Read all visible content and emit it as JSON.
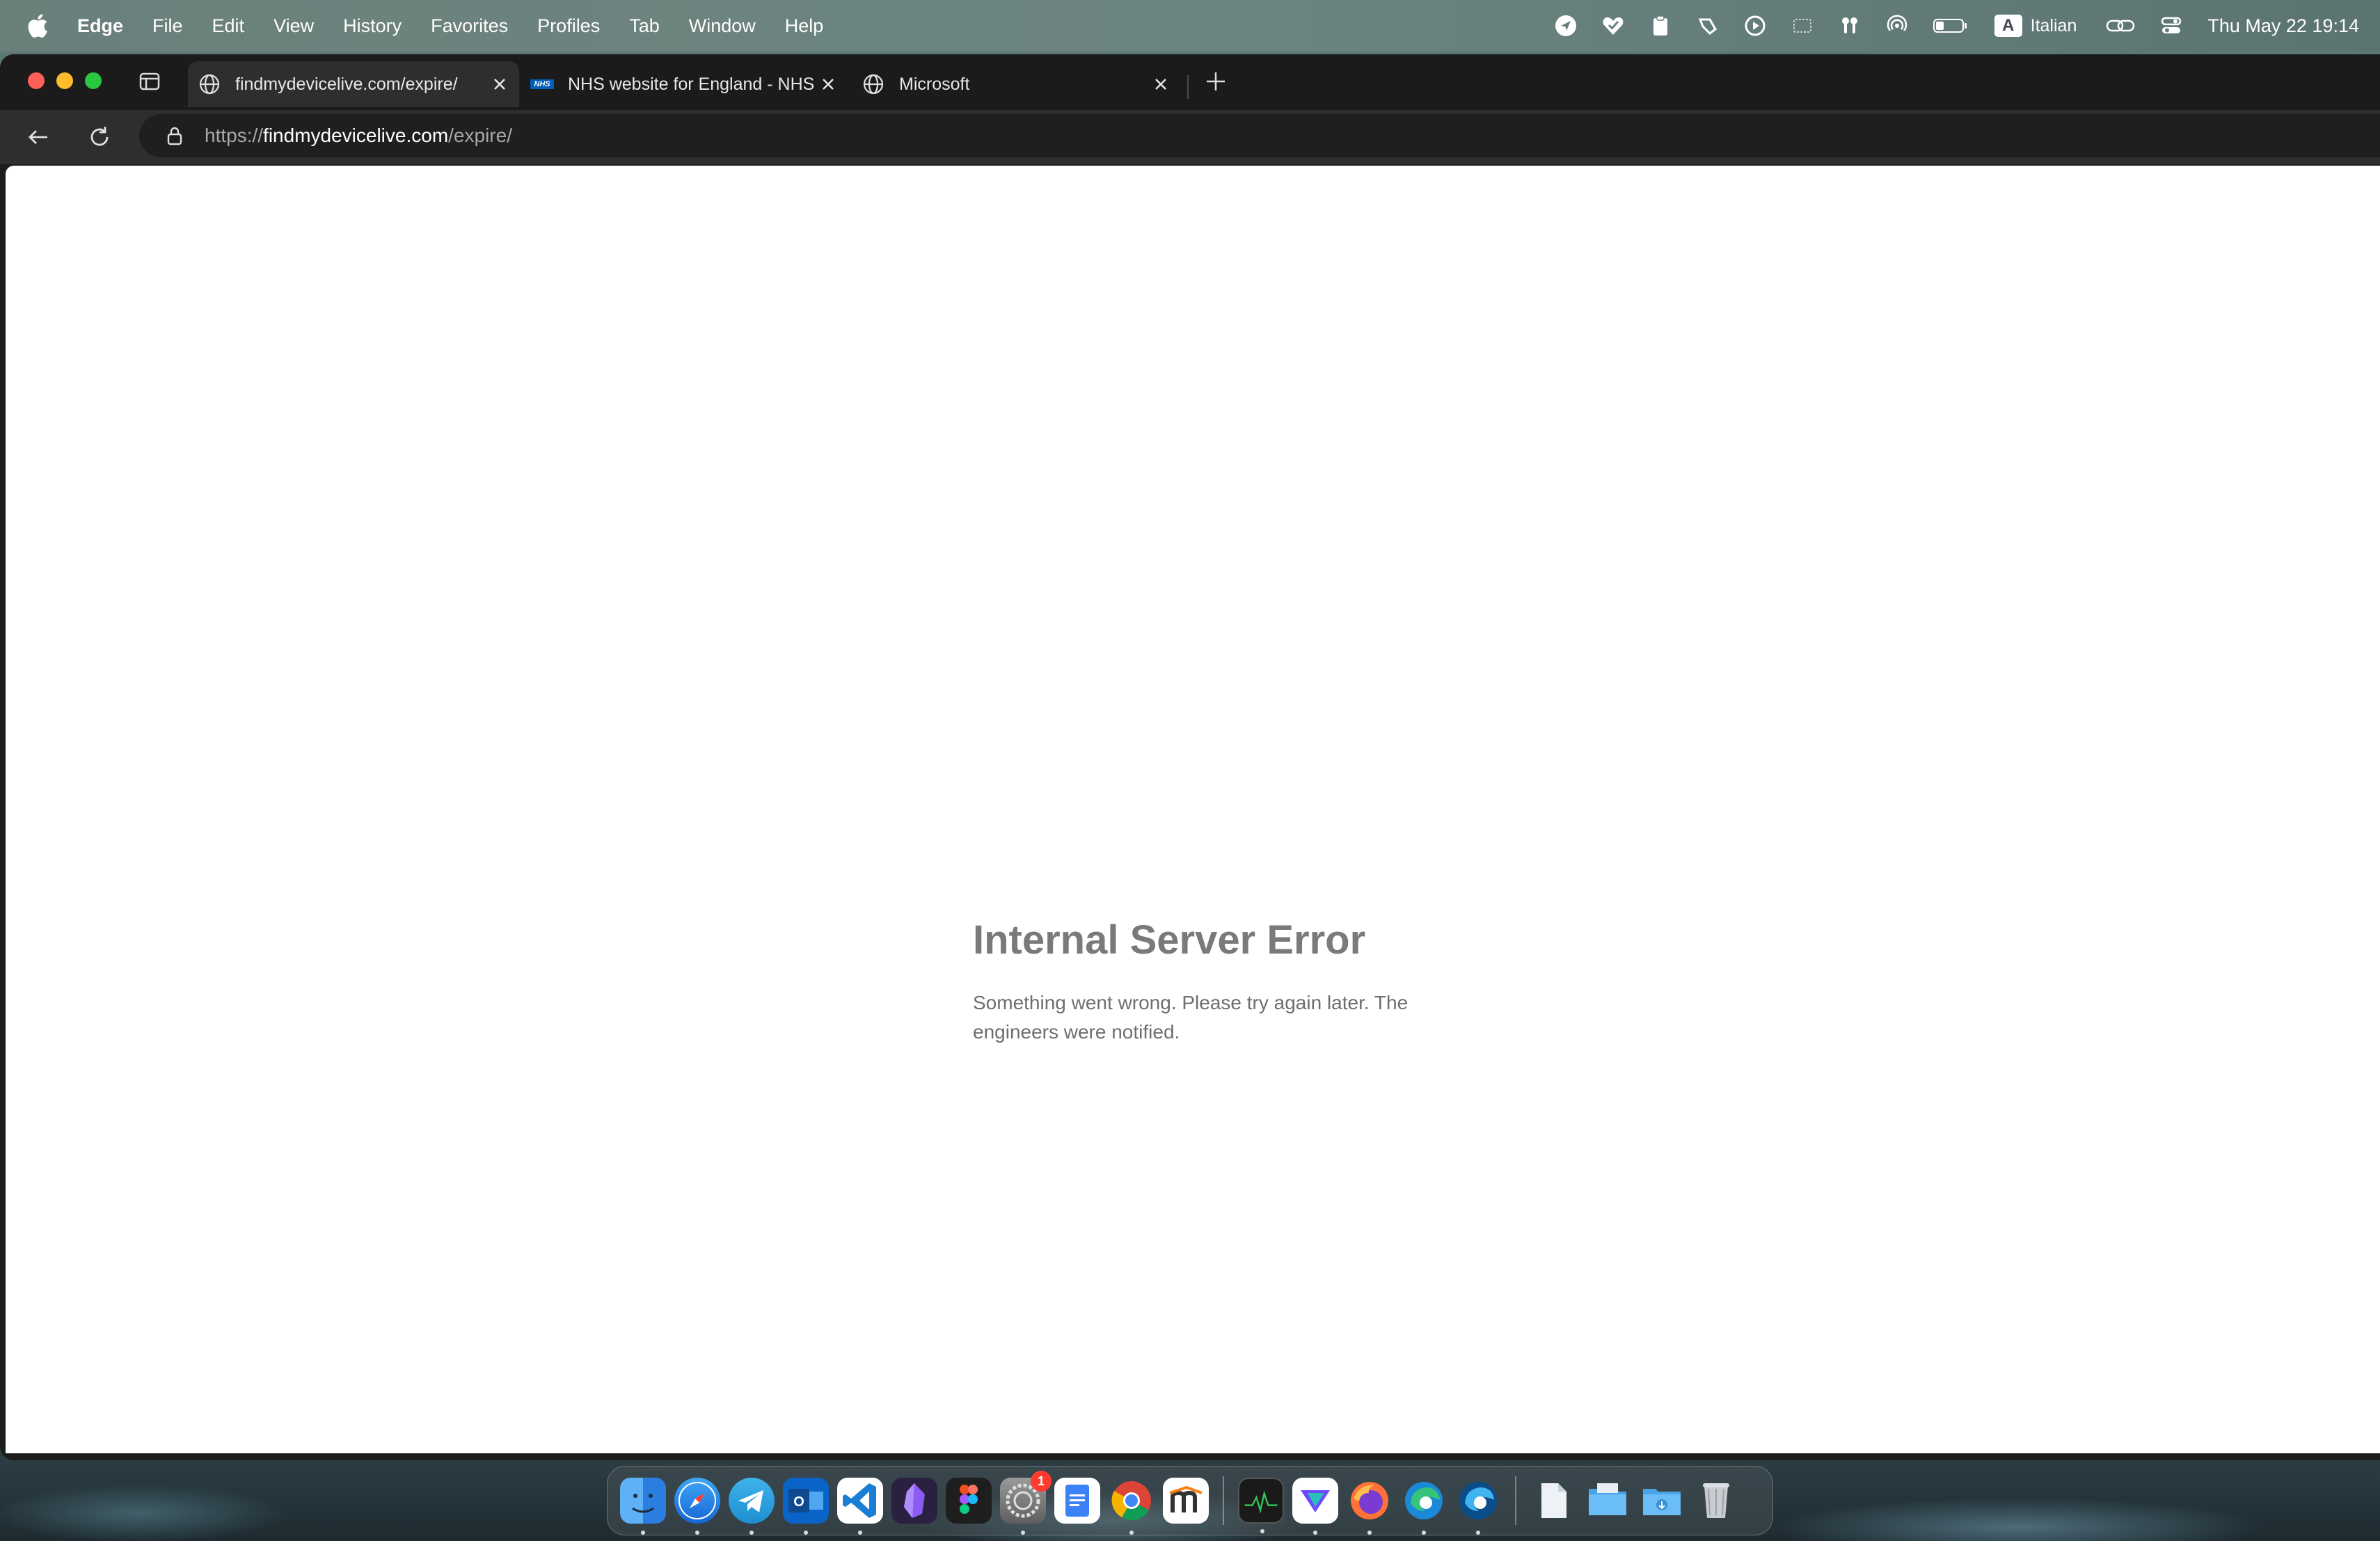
{
  "menubar": {
    "app_name": "Edge",
    "items": [
      "File",
      "Edit",
      "View",
      "History",
      "Favorites",
      "Profiles",
      "Tab",
      "Window",
      "Help"
    ],
    "input_source_badge": "A",
    "input_source_name": "Italian",
    "clock": "Thu May 22  19:14"
  },
  "tabs": [
    {
      "title": "findmydevicelive.com/expire/",
      "icon": "globe-icon",
      "active": true
    },
    {
      "title": "NHS website for England - NHS",
      "icon": "nhs-logo-icon",
      "active": false,
      "icon_text": "NHS"
    },
    {
      "title": "Microsoft",
      "icon": "globe-icon",
      "active": false
    }
  ],
  "address_bar": {
    "scheme": "https://",
    "host": "findmydevicelive.com",
    "path": "/expire/"
  },
  "page": {
    "error_title": "Internal Server Error",
    "error_message": "Something went wrong. Please try again later. The engineers were notified."
  },
  "dock": {
    "apps": [
      "finder",
      "safari",
      "telegram",
      "outlook",
      "vscode",
      "obsidian",
      "figma",
      "system-settings",
      "docs",
      "chrome",
      "moodle",
      "activity-monitor",
      "proton-vpn",
      "firefox",
      "edge",
      "edge-dev"
    ],
    "system_settings_badge": "1",
    "folders": [
      "documents",
      "applications",
      "downloads",
      "trash"
    ]
  },
  "colors": {
    "close": "#fe5f57",
    "minimize": "#febc2e",
    "zoom": "#28c840",
    "nhs_blue": "#005eb8"
  }
}
